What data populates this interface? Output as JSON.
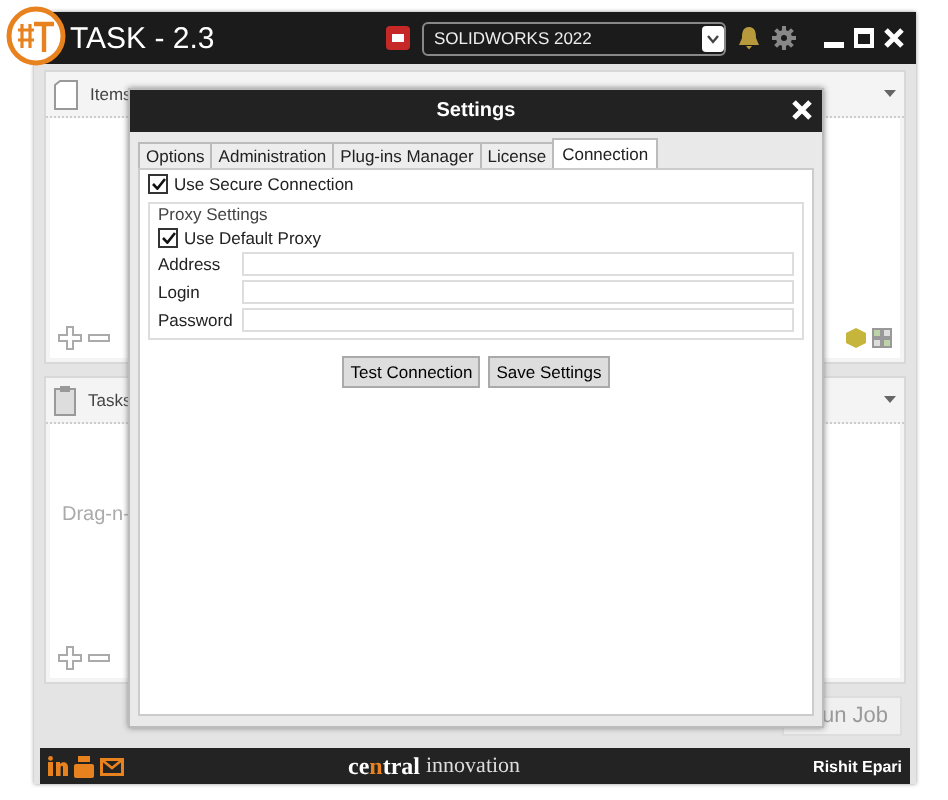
{
  "window": {
    "title": "TASK - 2.3",
    "cad_select": {
      "value": "SOLIDWORKS 2022"
    }
  },
  "items_panel": {
    "title": "Items"
  },
  "tasks_panel": {
    "title": "Tasks",
    "hint": "Drag-n-"
  },
  "run_button": "un Job",
  "footer": {
    "brand": [
      {
        "text": "ce",
        "accent": false
      },
      {
        "text": "n",
        "accent": true
      },
      {
        "text": "tral",
        "accent": false
      }
    ],
    "brand_suffix": "innovation",
    "user": "Rishit Epari"
  },
  "dialog": {
    "title": "Settings",
    "tabs": [
      {
        "label": "Options",
        "selected": false
      },
      {
        "label": "Administration",
        "selected": false
      },
      {
        "label": "Plug-ins Manager",
        "selected": false
      },
      {
        "label": "License",
        "selected": false
      },
      {
        "label": "Connection",
        "selected": true
      }
    ],
    "secure": {
      "label": "Use Secure Connection",
      "checked": true
    },
    "proxy": {
      "legend": "Proxy Settings",
      "default_proxy": {
        "label": "Use Default Proxy",
        "checked": true
      },
      "fields": [
        {
          "label": "Address"
        },
        {
          "label": "Login"
        },
        {
          "label": "Password"
        }
      ]
    },
    "buttons": [
      "Test Connection",
      "Save Settings"
    ]
  }
}
